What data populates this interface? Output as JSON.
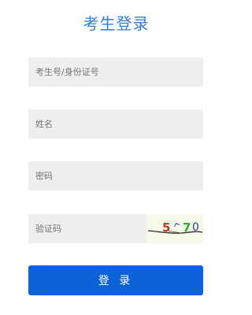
{
  "page": {
    "title": "考生登录"
  },
  "form": {
    "id_field": {
      "placeholder": "考生号/身份证号",
      "value": ""
    },
    "name_field": {
      "placeholder": "姓名",
      "value": ""
    },
    "password_field": {
      "placeholder": "密码",
      "value": ""
    },
    "captcha_field": {
      "placeholder": "验证码",
      "value": ""
    },
    "captcha_image": {
      "text": "5^70",
      "colors": [
        "#c0392b",
        "#2c3e9c",
        "#2fae2f",
        "#2c3e9c"
      ]
    },
    "login_button": {
      "label": "登 录"
    }
  },
  "colors": {
    "title": "#2f7ed8",
    "button": "#0e62d8",
    "field_background": "#eeeeee"
  }
}
